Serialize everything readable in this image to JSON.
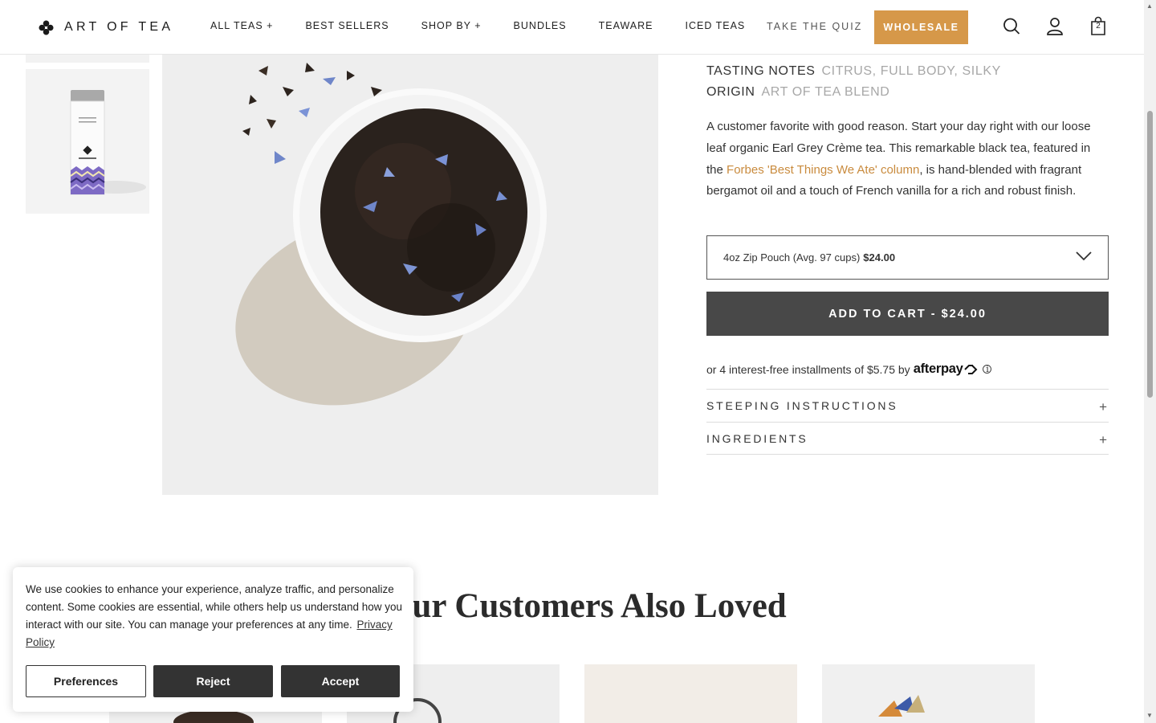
{
  "header": {
    "logo_text": "ART OF TEA",
    "nav": [
      "ALL TEAS +",
      "BEST SELLERS",
      "SHOP BY +",
      "BUNDLES",
      "TEAWARE",
      "ICED TEAS"
    ],
    "quiz_label": "TAKE THE QUIZ",
    "wholesale_label": "WHOLESALE",
    "cart_count": "2",
    "icons": [
      "search-icon",
      "account-icon",
      "cart-icon"
    ],
    "accent_color": "#d69849"
  },
  "product": {
    "tasting_label": "TASTING NOTES",
    "tasting_value": "CITRUS, FULL BODY, SILKY",
    "origin_label": "ORIGIN",
    "origin_value": "ART OF TEA BLEND",
    "desc_part1": "A customer favorite with good reason. Start your day right with our loose leaf organic Earl Grey Crème tea. This remarkable black tea, featured in the ",
    "desc_link": "Forbes 'Best Things We Ate' column",
    "desc_part2": ", is hand-blended with fragrant bergamot oil and a touch of French vanilla for a rich and robust finish.",
    "size_option": "4oz Zip Pouch (Avg. 97 cups)",
    "size_price": "$24.00",
    "add_to_cart": "ADD TO CART - $24.00",
    "installments_text": "or 4 interest-free installments of $5.75 by",
    "afterpay_brand": "afterpay",
    "accordions": [
      "STEEPING INSTRUCTIONS",
      "INGREDIENTS"
    ]
  },
  "section": {
    "also_loved": "Our Customers Also Loved"
  },
  "cookie": {
    "text": "We use cookies to enhance your experience, analyze traffic, and personalize content. Some cookies are essential, while others help us understand how you interact with our site. You can manage your preferences at any time.",
    "privacy_link": "Privacy Policy",
    "preferences": "Preferences",
    "reject": "Reject",
    "accept": "Accept"
  }
}
